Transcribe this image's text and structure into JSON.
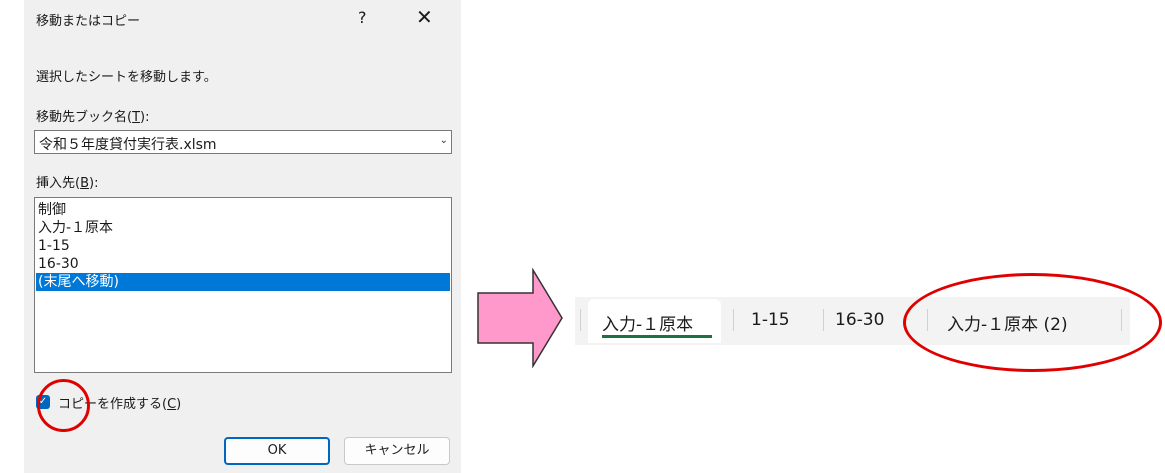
{
  "dialog": {
    "title": "移動またはコピー",
    "help_label": "?",
    "close_label": "✕",
    "description": "選択したシートを移動します。",
    "book_label_pre": "移動先ブック名(",
    "book_label_key": "T",
    "book_label_post": "):",
    "book_value": "令和５年度貸付実行表.xlsm",
    "insert_label_pre": "挿入先(",
    "insert_label_key": "B",
    "insert_label_post": "):",
    "sheets": [
      "制御",
      "入力-１原本",
      "1-15",
      "16-30",
      "(末尾へ移動)"
    ],
    "selected_index": 4,
    "copy_checked": true,
    "copy_label_pre": "コピーを作成する(",
    "copy_label_key": "C",
    "copy_label_post": ")",
    "ok_label": "OK",
    "cancel_label": "キャンセル"
  },
  "tabs": {
    "items": [
      "入力-１原本",
      "1-15",
      "16-30",
      "入力-１原本 (2)"
    ],
    "active_index": 0
  },
  "colors": {
    "selection": "#0078d7",
    "highlight_circle": "#e00000",
    "arrow_fill": "#ff99cc",
    "active_tab_underline": "#1e7145"
  }
}
